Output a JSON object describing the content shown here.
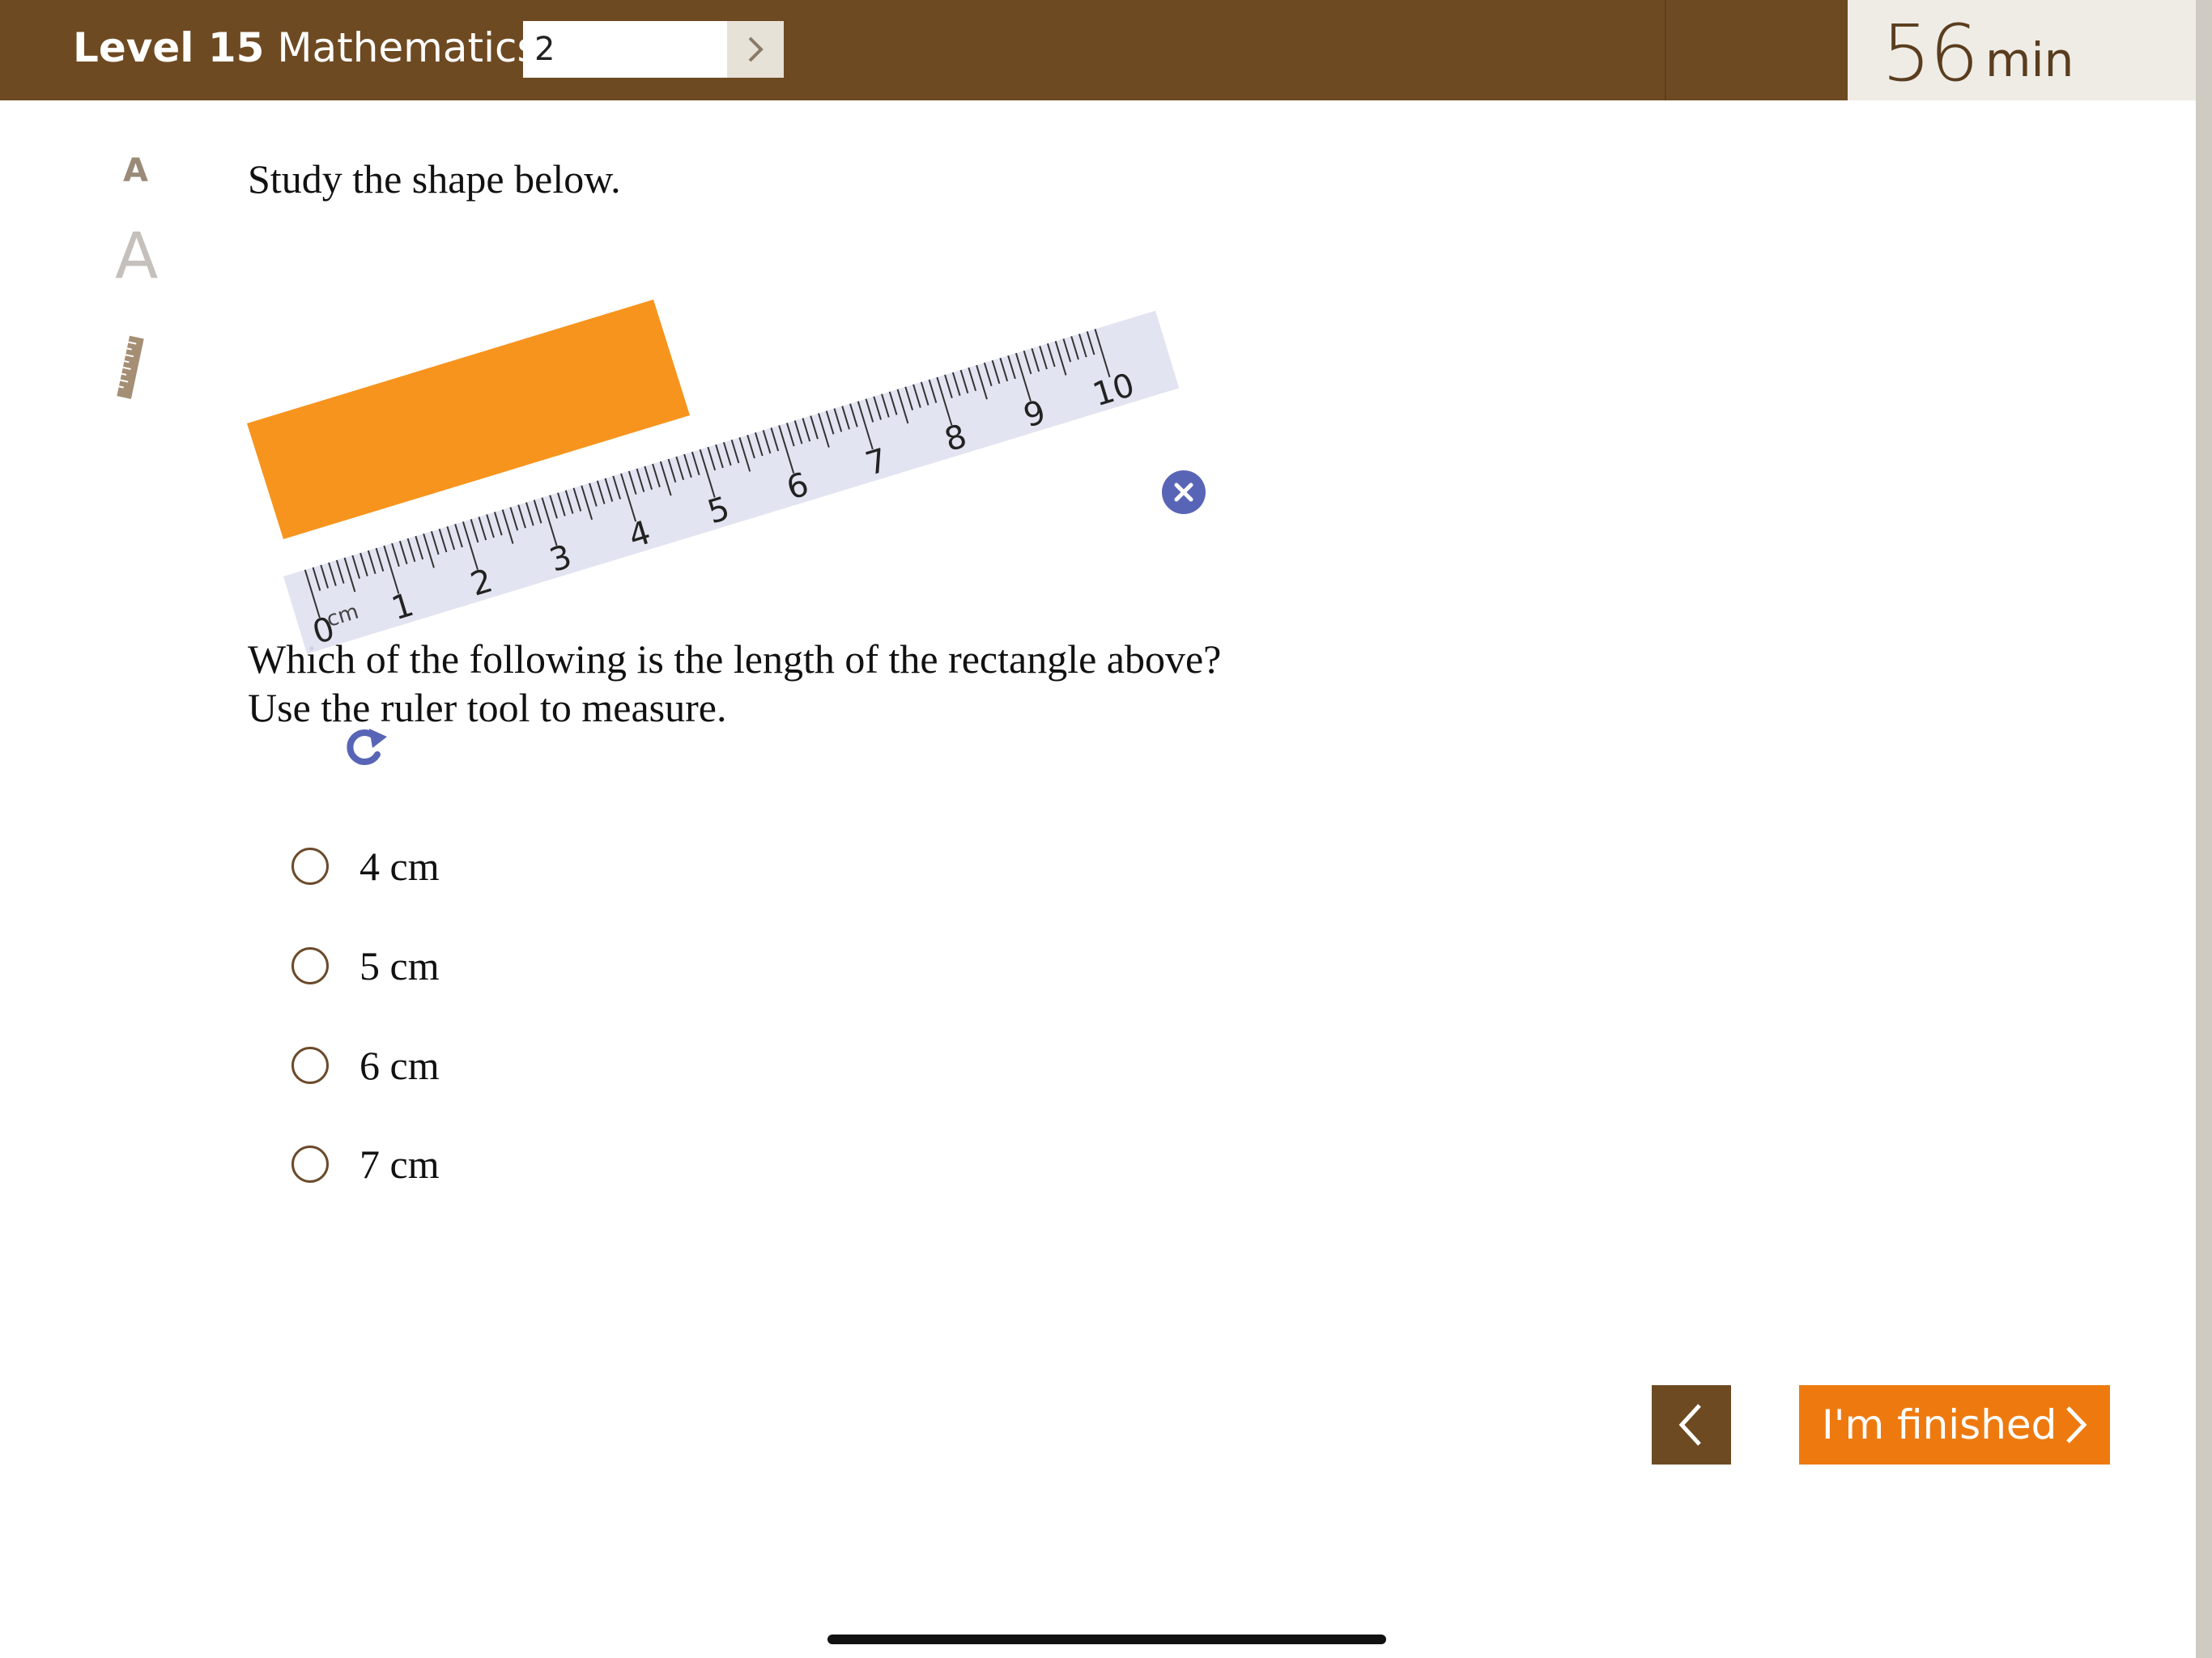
{
  "header": {
    "level_label": "Level 15",
    "subject": "Mathematics",
    "question_number": "2",
    "go_icon": "chevron-right-icon",
    "timer_value": "56",
    "timer_unit": "min",
    "colors": {
      "bar": "#6e4a22",
      "timer_bg": "#efece6"
    }
  },
  "tools": {
    "font_small": "A",
    "font_large": "A",
    "ruler_icon": "ruler-icon"
  },
  "question": {
    "prompt": "Study the shape below.",
    "text_line1": "Which of the following is the length of the rectangle above?",
    "text_line2": "Use the ruler tool to measure."
  },
  "ruler": {
    "unit": "cm",
    "numbers": [
      "0",
      "1",
      "2",
      "3",
      "4",
      "5",
      "6",
      "7",
      "8",
      "9",
      "10"
    ],
    "close_icon": "close-icon",
    "rotate_icon": "rotate-icon",
    "colors": {
      "body": "#dfe2f0",
      "handle": "#5865b6"
    }
  },
  "shape": {
    "fill": "#f7941d"
  },
  "options": [
    {
      "label": "4 cm"
    },
    {
      "label": "5 cm"
    },
    {
      "label": "6 cm"
    },
    {
      "label": "7 cm"
    }
  ],
  "nav": {
    "prev_icon": "chevron-left-icon",
    "finish_label": "I'm finished",
    "finish_icon": "chevron-right-icon",
    "colors": {
      "prev": "#6e4a22",
      "finish": "#ee7a0f"
    }
  }
}
